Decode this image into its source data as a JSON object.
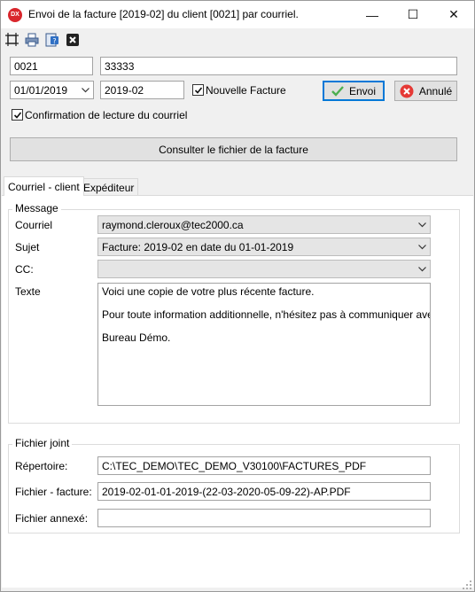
{
  "window": {
    "title": "Envoi de la facture [2019-02] du client [0021] par courriel.",
    "icon_text": "DX",
    "controls": {
      "minimize": "—",
      "maximize": "☐",
      "close": "✕"
    }
  },
  "toolbar": {
    "icons": [
      "fit-icon",
      "print-icon",
      "help-icon",
      "close-icon"
    ]
  },
  "header": {
    "client_code": "0021",
    "client_name": "33333",
    "date_value": "01/01/2019",
    "invoice_number": "2019-02",
    "new_invoice_label": "Nouvelle Facture",
    "new_invoice_checked": true,
    "send_label": "Envoi",
    "cancel_label": "Annulé",
    "read_confirm_label": "Confirmation de lecture du courriel",
    "read_confirm_checked": true,
    "view_invoice_label": "Consulter le fichier de la facture"
  },
  "tabs": [
    {
      "label": "Courriel - client",
      "active": true
    },
    {
      "label": "Expéditeur",
      "active": false
    }
  ],
  "message": {
    "group_label": "Message",
    "email_label": "Courriel",
    "email_value": "raymond.cleroux@tec2000.ca",
    "subject_label": "Sujet",
    "subject_value": "Facture: 2019-02 en date du 01-01-2019",
    "cc_label": "CC:",
    "cc_value": "",
    "text_label": "Texte",
    "text_lines": [
      "Voici une copie de votre plus récente facture.",
      "Pour toute information additionnelle, n'hésitez pas à communiquer avec la dire",
      "Bureau Démo."
    ]
  },
  "attachment": {
    "group_label": "Fichier joint",
    "directory_label": "Répertoire:",
    "directory_value": "C:\\TEC_DEMO\\TEC_DEMO_V30100\\FACTURES_PDF",
    "invoice_file_label": "Fichier - facture:",
    "invoice_file_value": "2019-02-01-01-2019-(22-03-2020-05-09-22)-AP.PDF",
    "annex_file_label": "Fichier annexé:",
    "annex_file_value": ""
  },
  "colors": {
    "accent": "#0078d7",
    "send_check": "#4caf50",
    "cancel_red": "#e53935"
  }
}
